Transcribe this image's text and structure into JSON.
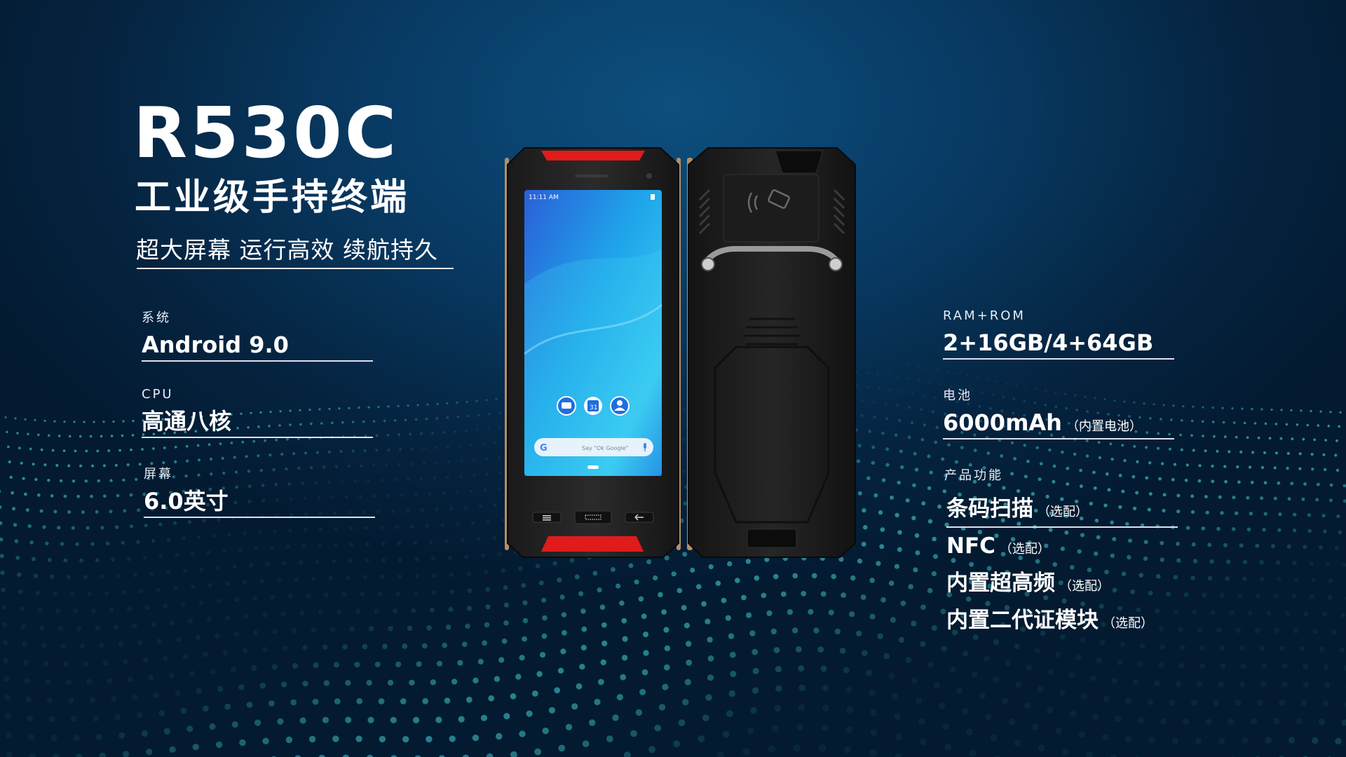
{
  "product": {
    "model": "R530C",
    "subtitle": "工业级手持终端",
    "tagline": "超大屏幕 运行高效 续航持久"
  },
  "specs_left": [
    {
      "label": "系统",
      "value": "Android 9.0"
    },
    {
      "label": "CPU",
      "value": "高通八核"
    },
    {
      "label": "屏幕",
      "value": "6.0英寸"
    }
  ],
  "specs_right": [
    {
      "label": "RAM+ROM",
      "value": "2+16GB/4+64GB",
      "note": ""
    },
    {
      "label": "电池",
      "value": "6000mAh",
      "note": "（内置电池）"
    }
  ],
  "features": {
    "label": "产品功能",
    "items": [
      {
        "name": "条码扫描",
        "note": "（选配）"
      },
      {
        "name": "NFC",
        "note": "（选配）"
      },
      {
        "name": "内置超高频",
        "note": "（选配）"
      },
      {
        "name": "内置二代证模块",
        "note": "（选配）"
      }
    ]
  },
  "device_screen": {
    "status_time": "11:11 AM",
    "calendar_day": "31",
    "search_hint": "Say \"Ok Google\"",
    "google_letter": "G"
  },
  "colors": {
    "background": "#05233f",
    "accent_red": "#e01b1b",
    "dots": "#3fc2c9"
  },
  "icons": [
    "nfc-icon",
    "messages-icon",
    "calendar-icon",
    "contacts-icon",
    "mic-icon",
    "menu-key-icon",
    "home-key-icon",
    "back-key-icon"
  ]
}
